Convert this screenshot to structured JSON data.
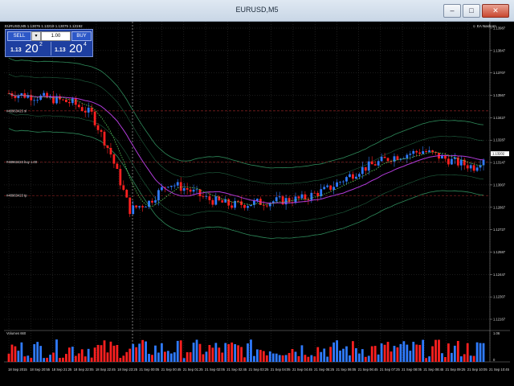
{
  "window": {
    "title": "EURUSD,M5",
    "controls": {
      "minimize": "–",
      "maximize": "□",
      "close": "✕"
    }
  },
  "chart_header": {
    "ticker": "EURUSD,M5  1.13076 1.13219 1.13075 1.13192",
    "ea_label": "EA Nashorn",
    "ea_icon": "smiley-icon"
  },
  "trade_panel": {
    "sell_label": "SELL",
    "buy_label": "BUY",
    "lot_value": "1.00",
    "lot_arrow": "▾",
    "bid": {
      "lead": "1.13",
      "big": "20",
      "sup": "2"
    },
    "ask": {
      "lead": "1.13",
      "big": "20",
      "sup": "4"
    }
  },
  "order_lines": [
    {
      "label": "#48963423 sl",
      "price": 1.1347
    },
    {
      "label": "#48963423 buy 1.00",
      "price": 1.1315
    },
    {
      "label": "#48963423 tp",
      "price": 1.1294
    }
  ],
  "price_axis": {
    "ticks": [
      "1.13987",
      "1.13847",
      "1.13707",
      "1.13567",
      "1.13427",
      "1.13287",
      "1.13147",
      "1.13007",
      "1.12867",
      "1.12727",
      "1.12587",
      "1.12447",
      "1.12307",
      "1.12167"
    ],
    "current_price": "1.13202",
    "current_price_value": 1.13202
  },
  "volume_panel": {
    "label": "Volumes 660",
    "scale_top": "1.06",
    "scale_bottom": "0"
  },
  "time_axis": {
    "ticks": [
      "18 Sep 2015",
      "18 Sep 20:55",
      "18 Sep 21:25",
      "18 Sep 22:05",
      "18 Sep 22:45",
      "18 Sep 23:25",
      "21 Sep 00:05",
      "21 Sep 00:45",
      "21 Sep 01:25",
      "21 Sep 02:05",
      "21 Sep 02:45",
      "21 Sep 03:25",
      "21 Sep 04:05",
      "21 Sep 04:45",
      "21 Sep 05:25",
      "21 Sep 06:05",
      "21 Sep 06:45",
      "21 Sep 07:25",
      "21 Sep 08:05",
      "21 Sep 08:45",
      "21 Sep 09:25",
      "21 Sep 10:05",
      "21 Sep 10:45"
    ]
  },
  "colors": {
    "bull": "#2f7bff",
    "bear": "#ff2020",
    "grid": "#3a3a3a",
    "ma_fast": "#b03bd8",
    "ma_slow": "#5bd35b",
    "bands": "#2e8a5a",
    "order_line": "#7a1e1e",
    "trade_panel": "#1e3fa0"
  }
}
